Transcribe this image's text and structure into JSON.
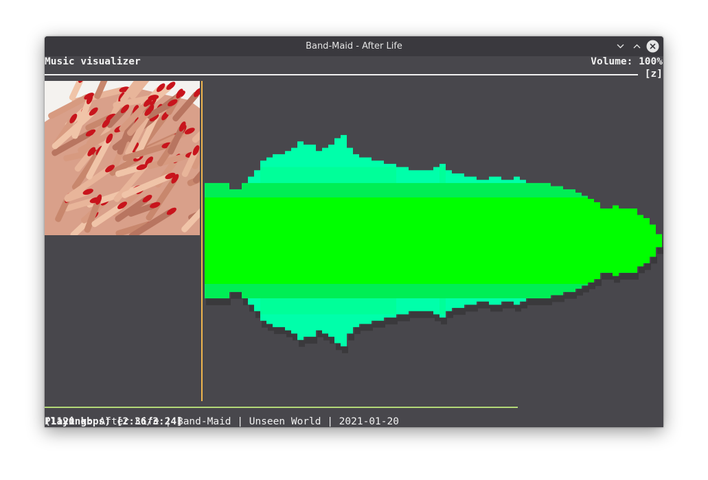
{
  "window": {
    "title": "Band-Maid - After Life",
    "background": "#48474c",
    "titlebar_background": "#3a393e"
  },
  "header": {
    "title": "Music visualizer",
    "volume_label": "Volume: 100%",
    "toggle_key": "[z]"
  },
  "album_art": {
    "icon": "album-cover-image"
  },
  "visualizer": {
    "colors": {
      "center": "#00ff00",
      "middle": "#00ee55",
      "outer": "#00ff99",
      "edge": "#00ffaa",
      "shadow": "#3a393c"
    },
    "center_band": 0.135,
    "middle_band": 0.18,
    "outer_band": 0.23,
    "bars": [
      0.18,
      0.18,
      0.18,
      0.18,
      0.16,
      0.16,
      0.18,
      0.2,
      0.22,
      0.25,
      0.26,
      0.27,
      0.27,
      0.28,
      0.29,
      0.31,
      0.3,
      0.3,
      0.28,
      0.29,
      0.3,
      0.32,
      0.33,
      0.29,
      0.27,
      0.26,
      0.26,
      0.25,
      0.25,
      0.24,
      0.24,
      0.23,
      0.23,
      0.22,
      0.22,
      0.22,
      0.22,
      0.23,
      0.24,
      0.22,
      0.21,
      0.21,
      0.2,
      0.2,
      0.19,
      0.19,
      0.2,
      0.2,
      0.19,
      0.19,
      0.2,
      0.19,
      0.18,
      0.18,
      0.18,
      0.18,
      0.17,
      0.17,
      0.16,
      0.16,
      0.15,
      0.14,
      0.13,
      0.12,
      0.1,
      0.1,
      0.11,
      0.1,
      0.1,
      0.1,
      0.08,
      0.07,
      0.05,
      0.02
    ]
  },
  "status": {
    "playing_label": "Playing:",
    "track_info": "After Life | Band-Maid | Unseen World | 2021-01-20",
    "bitrate_time": "(1120 kbps) [2:36/3:24]",
    "progress": 0.765
  }
}
